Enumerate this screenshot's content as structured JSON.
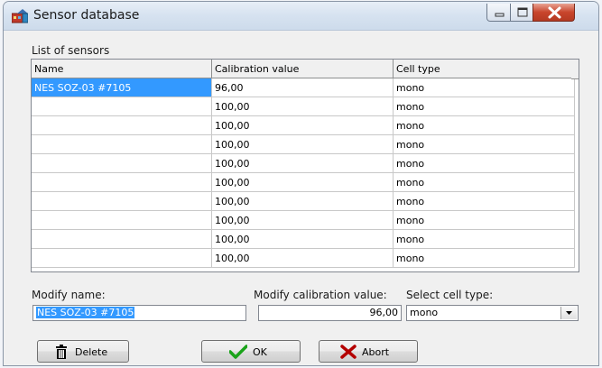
{
  "window": {
    "title": "Sensor database",
    "icon": "database-app-icon",
    "controls": [
      "minimize-icon",
      "maximize-icon",
      "close-icon"
    ]
  },
  "sensors_list": {
    "label": "List of sensors",
    "columns": [
      "Name",
      "Calibration value",
      "Cell type"
    ],
    "rows": [
      [
        "NES SOZ-03 #7105",
        "96,00",
        "mono"
      ],
      [
        "",
        "100,00",
        "mono"
      ],
      [
        "",
        "100,00",
        "mono"
      ],
      [
        "",
        "100,00",
        "mono"
      ],
      [
        "",
        "100,00",
        "mono"
      ],
      [
        "",
        "100,00",
        "mono"
      ],
      [
        "",
        "100,00",
        "mono"
      ],
      [
        "",
        "100,00",
        "mono"
      ],
      [
        "",
        "100,00",
        "mono"
      ],
      [
        "",
        "100,00",
        "mono"
      ]
    ]
  },
  "form": {
    "modify_name_label": "Modify name:",
    "modify_name_value": "NES SOZ-03 #7105",
    "modify_calibration_label": "Modify calibration value:",
    "modify_calibration_value": "96,00",
    "cell_type_label": "Select cell type:",
    "cell_type_value": "mono"
  },
  "buttons": {
    "delete": "Delete",
    "ok": "OK",
    "abort": "Abort"
  },
  "colors": {
    "selection": "#3399ff",
    "ok_check": "#1aa31a",
    "abort_x": "#b40000"
  }
}
